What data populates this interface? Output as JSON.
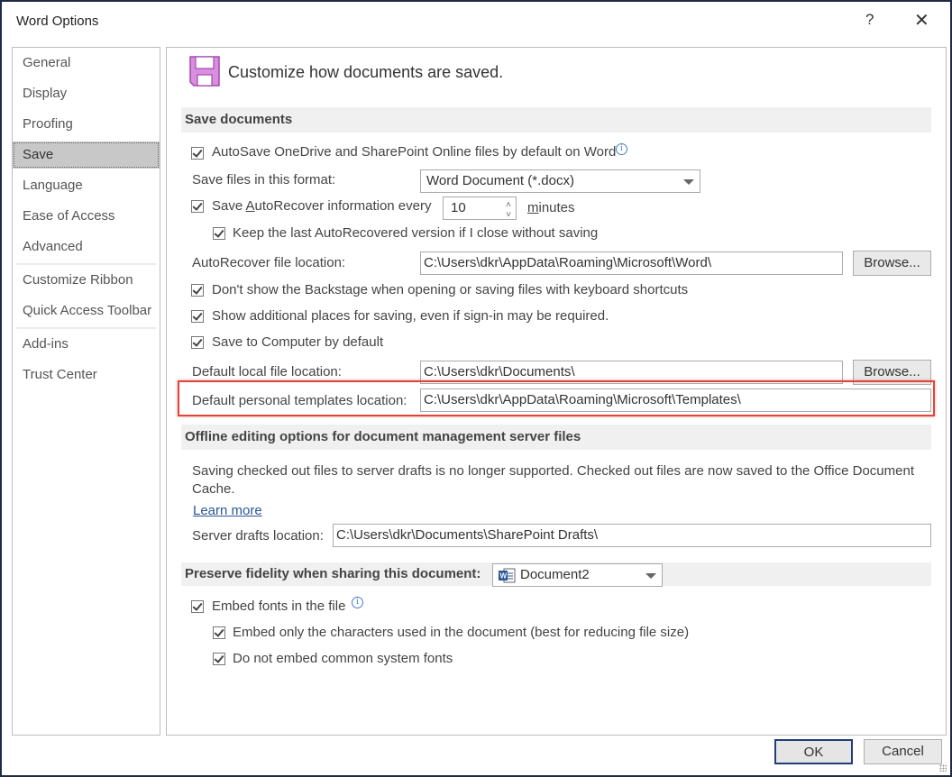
{
  "window": {
    "title": "Word Options",
    "help_label": "?",
    "close_label": "✕"
  },
  "sidebar": {
    "items": [
      {
        "label": "General"
      },
      {
        "label": "Display"
      },
      {
        "label": "Proofing"
      },
      {
        "label": "Save",
        "selected": true
      },
      {
        "label": "Language"
      },
      {
        "label": "Ease of Access"
      },
      {
        "label": "Advanced"
      },
      {
        "label": "Customize Ribbon"
      },
      {
        "label": "Quick Access Toolbar"
      },
      {
        "label": "Add-ins"
      },
      {
        "label": "Trust Center"
      }
    ]
  },
  "header": {
    "icon": "floppy-disk-icon",
    "text": "Customize how documents are saved.",
    "icon_color": "#c774d4"
  },
  "save_documents": {
    "section_title": "Save documents",
    "autosave_label": "AutoSave OneDrive and SharePoint Online files by default on Word",
    "autosave_checked": true,
    "format_label": "Save files in this format:",
    "format_value": "Word Document (*.docx)",
    "autorecover_label_pre": "Save ",
    "autorecover_label_u": "A",
    "autorecover_label_post": "utoRecover information every",
    "autorecover_checked": true,
    "autorecover_minutes": "10",
    "minutes_label": "minutes",
    "keep_last_label": "Keep the last AutoRecovered version if I close without saving",
    "keep_last_checked": true,
    "autorecover_location_label": "AutoRecover file location:",
    "autorecover_location_value": "C:\\Users\\dkr\\AppData\\Roaming\\Microsoft\\Word\\",
    "browse_label": "Browse...",
    "backstage_label": "Don't show the Backstage when opening or saving files with keyboard shortcuts",
    "backstage_checked": true,
    "additional_places_label": "Show additional places for saving, even if sign-in may be required.",
    "additional_places_checked": true,
    "save_to_computer_label": "Save to Computer by default",
    "save_to_computer_checked": true,
    "default_local_label": "Default local file location:",
    "default_local_value": "C:\\Users\\dkr\\Documents\\",
    "templates_label": "Default personal templates location:",
    "templates_value": "C:\\Users\\dkr\\AppData\\Roaming\\Microsoft\\Templates\\"
  },
  "offline": {
    "section_title": "Offline editing options for document management server files",
    "message": "Saving checked out files to server drafts is no longer supported. Checked out files are now saved to the Office Document Cache.",
    "learn_more": "Learn more",
    "server_drafts_label": "Server drafts location:",
    "server_drafts_value": "C:\\Users\\dkr\\Documents\\SharePoint Drafts\\"
  },
  "fidelity": {
    "section_title": "Preserve fidelity when sharing this document:",
    "document_value": "Document2",
    "embed_fonts_label": "Embed fonts in the file",
    "embed_fonts_checked": true,
    "embed_only_label": "Embed only the characters used in the document (best for reducing file size)",
    "embed_only_checked": true,
    "no_common_label": "Do not embed common system fonts",
    "no_common_checked": true
  },
  "footer": {
    "ok_label": "OK",
    "cancel_label": "Cancel"
  },
  "colors": {
    "highlight": "#e0443a",
    "ok_border": "#1f3f7a",
    "link": "#2b5797"
  }
}
